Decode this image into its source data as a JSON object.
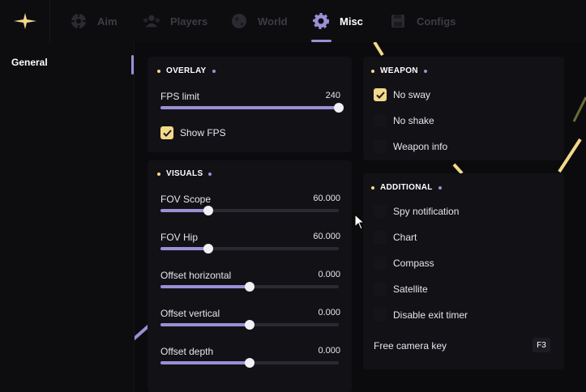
{
  "tabs": [
    {
      "label": "Aim",
      "icon": "crosshair-icon"
    },
    {
      "label": "Players",
      "icon": "players-icon"
    },
    {
      "label": "World",
      "icon": "globe-icon"
    },
    {
      "label": "Misc",
      "icon": "gear-icon"
    },
    {
      "label": "Configs",
      "icon": "save-icon"
    }
  ],
  "active_tab": "Misc",
  "sidebar": {
    "items": [
      {
        "label": "General"
      }
    ]
  },
  "overlay": {
    "title": "OVERLAY",
    "fps_limit": {
      "label": "FPS limit",
      "value": "240",
      "level": 1.0
    },
    "show_fps": {
      "label": "Show FPS",
      "checked": true
    }
  },
  "visuals": {
    "title": "VISUALS",
    "sliders": [
      {
        "label": "FOV Scope",
        "value": "60.000",
        "level": 0.27
      },
      {
        "label": "FOV Hip",
        "value": "60.000",
        "level": 0.27
      },
      {
        "label": "Offset horizontal",
        "value": "0.000",
        "level": 0.5
      },
      {
        "label": "Offset vertical",
        "value": "0.000",
        "level": 0.5
      },
      {
        "label": "Offset depth",
        "value": "0.000",
        "level": 0.5
      }
    ]
  },
  "weapon": {
    "title": "WEAPON",
    "options": [
      {
        "label": "No sway",
        "checked": true
      },
      {
        "label": "No shake",
        "checked": false
      },
      {
        "label": "Weapon info",
        "checked": false
      }
    ]
  },
  "additional": {
    "title": "ADDITIONAL",
    "options": [
      {
        "label": "Spy notification",
        "checked": false
      },
      {
        "label": "Chart",
        "checked": false
      },
      {
        "label": "Compass",
        "checked": false
      },
      {
        "label": "Satellite",
        "checked": false
      },
      {
        "label": "Disable exit timer",
        "checked": false
      }
    ],
    "free_camera_key": {
      "label": "Free camera key",
      "key": "F3"
    }
  },
  "colors": {
    "accent": "#9b8fd6",
    "highlight": "#f2d98a",
    "background": "#0b0b0e",
    "panel": "#121216"
  }
}
